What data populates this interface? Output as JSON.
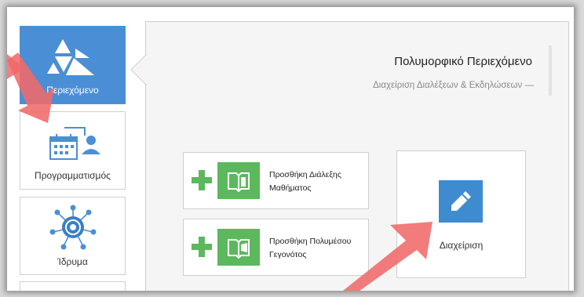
{
  "sidebar": {
    "items": [
      {
        "label": "Περιεχόμενο",
        "icon": "content-triangles-icon",
        "active": true
      },
      {
        "label": "Προγραμματισμός",
        "icon": "calendar-user-icon",
        "active": false
      },
      {
        "label": "Ίδρυμα",
        "icon": "institution-network-icon",
        "active": false
      }
    ]
  },
  "panel": {
    "title": "Πολυμορφικό Περιεχόμενο",
    "subtitle": "Διαχείριση Διαλέξεων & Εκδηλώσεων —"
  },
  "actions": {
    "add_lecture": {
      "line1": "Προσθήκη Διάλεξης",
      "line2": "Μαθήματος"
    },
    "add_event": {
      "line1": "Προσθήκη Πολυμέσου",
      "line2": "Γεγονότος"
    },
    "manage": {
      "label": "Διαχείριση"
    }
  },
  "colors": {
    "accent_blue": "#4a8fd6",
    "action_green": "#5cb85c",
    "annotation_arrow": "#f06a6a"
  }
}
